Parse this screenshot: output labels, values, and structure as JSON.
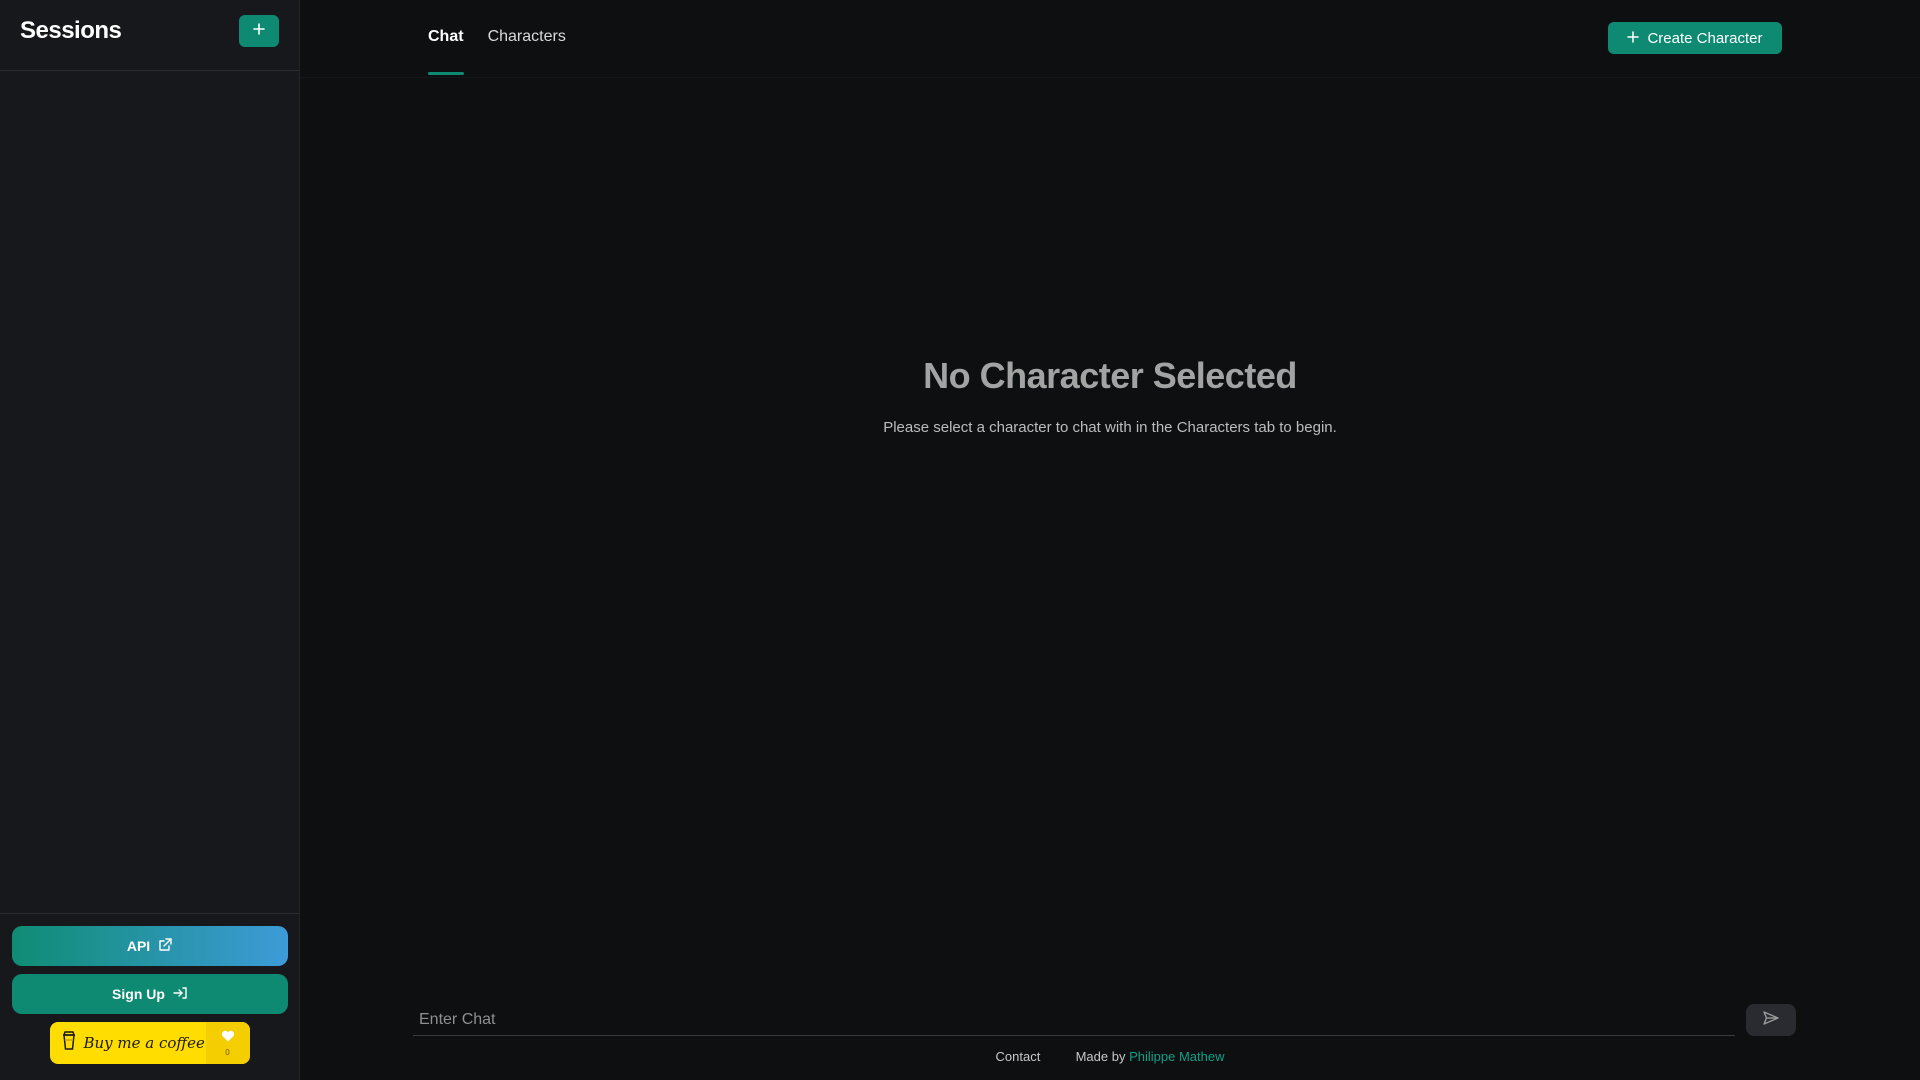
{
  "sidebar": {
    "title": "Sessions",
    "new_session_icon": "plus-icon",
    "api_label": "API",
    "api_icon": "external-link-icon",
    "signup_label": "Sign Up",
    "signup_icon": "sign-in-icon",
    "coffee_label": "Buy me a coffee",
    "coffee_icon": "coffee-cup-icon",
    "coffee_heart_icon": "heart-icon",
    "coffee_count": "0"
  },
  "tabs": [
    {
      "label": "Chat",
      "active": true
    },
    {
      "label": "Characters",
      "active": false
    }
  ],
  "header": {
    "create_label": "Create Character",
    "create_icon": "plus-icon"
  },
  "empty_state": {
    "title": "No Character Selected",
    "subtitle": "Please select a character to chat with in the Characters tab to begin."
  },
  "composer": {
    "placeholder": "Enter Chat",
    "value": "",
    "send_icon": "send-icon"
  },
  "footer": {
    "contact": "Contact",
    "made_by": "Made by",
    "author": "Philippe Mathew"
  },
  "colors": {
    "accent": "#0e8a72",
    "background": "#0e0f11",
    "sidebar": "#17181b",
    "coffee_yellow": "#ffdd00",
    "link": "#0fa086"
  }
}
